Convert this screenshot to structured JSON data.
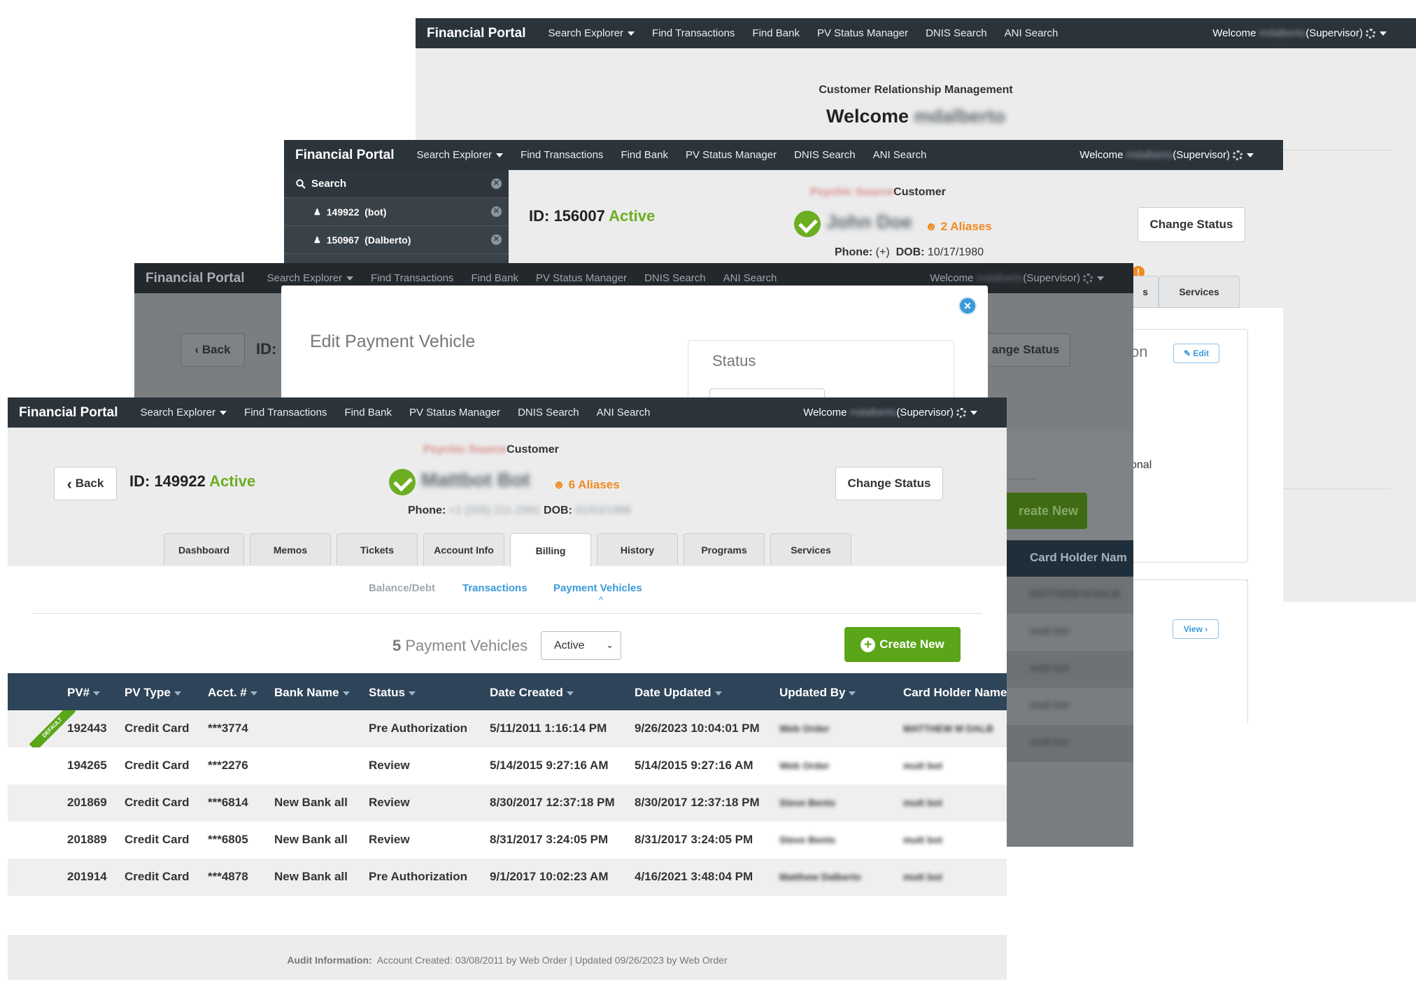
{
  "nav": {
    "brand": "Financial Portal",
    "search_explorer": "Search Explorer",
    "find_transactions": "Find Transactions",
    "find_bank": "Find Bank",
    "pv_status_manager": "PV Status Manager",
    "dnis_search": "DNIS Search",
    "ani_search": "ANI Search",
    "welcome": "Welcome",
    "user": "mdalberto",
    "role": "(Supervisor)"
  },
  "layer1": {
    "subtitle": "Customer Relationship Management",
    "welcome": "Welcome",
    "user": "mdalberto"
  },
  "layer2": {
    "search_label": "Search",
    "search_results": [
      {
        "id": "149922",
        "name": "(bot)"
      },
      {
        "id": "150967",
        "name": "(Dalberto)"
      }
    ],
    "id_label": "ID: 156007",
    "status": "Active",
    "brand_customer_prefix": "Psychic Source",
    "customer_label": "Customer",
    "customer_name": "John Doe",
    "aliases": "2 Aliases",
    "phone_label": "Phone:",
    "phone_value": "(+)",
    "dob_label": "DOB:",
    "dob_value": "10/17/1980",
    "change_status": "Change Status",
    "tab_partial": "s",
    "tab_services": "Services",
    "section_partial": "on",
    "edit": "Edit",
    "view": "View",
    "text_partial": "onal"
  },
  "layer3": {
    "back": "Back",
    "id_partial": "ID:",
    "change_status_partial": "ange Status",
    "modal_title": "Edit Payment Vehicle",
    "status_label": "Status",
    "create_new_partial": "reate New",
    "card_holder_partial": "Card Holder Nam",
    "row_names": [
      "MATTHEW M DALB",
      "mutt bot",
      "mutt bot",
      "mutt bot",
      "mutt bot"
    ]
  },
  "main": {
    "back": "Back",
    "id_label": "ID: 149922",
    "status": "Active",
    "brand_customer_prefix": "Psychic Source",
    "customer_label": "Customer",
    "customer_name": "Mattbot Bot",
    "aliases": "6 Aliases",
    "phone_label": "Phone:",
    "phone_value": "+1 (555) 211-2991",
    "dob_label": "DOB:",
    "dob_value": "02/03/1986",
    "change_status": "Change Status",
    "tabs": [
      "Dashboard",
      "Memos",
      "Tickets",
      "Account Info",
      "Billing",
      "History",
      "Programs",
      "Services"
    ],
    "active_tab": "Billing",
    "subtabs": [
      "Balance/Debt",
      "Transactions",
      "Payment Vehicles"
    ],
    "pv_count": "5",
    "pv_label": "Payment Vehicles",
    "filter_selected": "Active",
    "create_new": "Create New",
    "columns": [
      "PV#",
      "PV Type",
      "Acct. #",
      "Bank Name",
      "Status",
      "Date Created",
      "Date Updated",
      "Updated By",
      "Card Holder Name"
    ],
    "default_ribbon": "DEFAULT",
    "rows": [
      {
        "pv": "192443",
        "type": "Credit Card",
        "acct": "***3774",
        "bank": "",
        "status": "Pre Authorization",
        "created": "5/11/2011 1:16:14 PM",
        "updated": "9/26/2023 10:04:01 PM",
        "by": "Web Order",
        "holder": "MATTHEW M DALB"
      },
      {
        "pv": "194265",
        "type": "Credit Card",
        "acct": "***2276",
        "bank": "",
        "status": "Review",
        "created": "5/14/2015 9:27:16 AM",
        "updated": "5/14/2015 9:27:16 AM",
        "by": "Web Order",
        "holder": "mutt bot"
      },
      {
        "pv": "201869",
        "type": "Credit Card",
        "acct": "***6814",
        "bank": "New Bank all",
        "status": "Review",
        "created": "8/30/2017 12:37:18 PM",
        "updated": "8/30/2017 12:37:18 PM",
        "by": "Steve Bents",
        "holder": "mutt bot"
      },
      {
        "pv": "201889",
        "type": "Credit Card",
        "acct": "***6805",
        "bank": "New Bank all",
        "status": "Review",
        "created": "8/31/2017 3:24:05 PM",
        "updated": "8/31/2017 3:24:05 PM",
        "by": "Steve Bents",
        "holder": "mutt bot"
      },
      {
        "pv": "201914",
        "type": "Credit Card",
        "acct": "***4878",
        "bank": "New Bank all",
        "status": "Pre Authorization",
        "created": "9/1/2017 10:02:23 AM",
        "updated": "4/16/2021 3:48:04 PM",
        "by": "Matthew Dalberto",
        "holder": "mutt bot"
      }
    ],
    "audit_label": "Audit Information:",
    "audit_text": "Account Created: 03/08/2011 by Web Order | Updated 09/26/2023 by Web Order"
  },
  "colors": {
    "nav_bg": "#2b333b",
    "active_green": "#6cae21",
    "create_green": "#5aa618",
    "alias_orange": "#f08a24",
    "link_blue": "#3a9ad9",
    "table_header": "#2e4458"
  }
}
